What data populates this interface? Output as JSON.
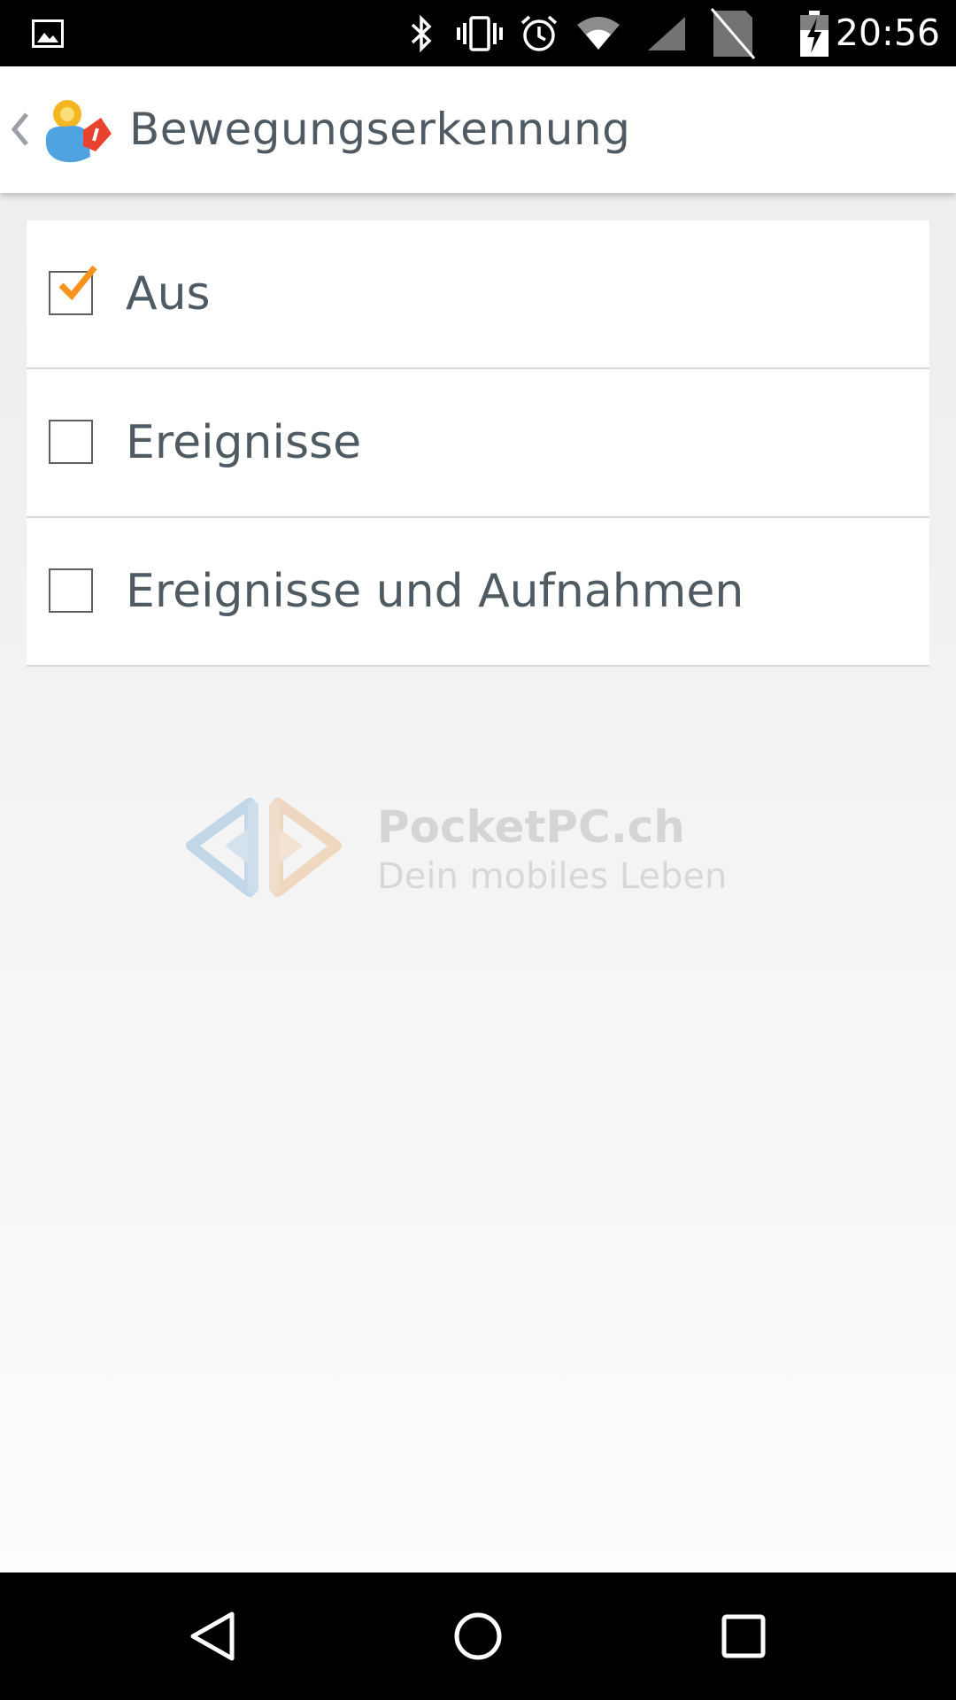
{
  "status_bar": {
    "time": "20:56",
    "icons": [
      "gallery-icon",
      "bluetooth-icon",
      "vibrate-icon",
      "alarm-icon",
      "wifi-icon",
      "signal-icon",
      "no-sim-icon",
      "battery-charging-icon"
    ]
  },
  "action_bar": {
    "title": "Bewegungserkennung",
    "back_icon": "chevron-left-icon",
    "app_icon": "app-logo-icon"
  },
  "options": [
    {
      "label": "Aus",
      "checked": true
    },
    {
      "label": "Ereignisse",
      "checked": false
    },
    {
      "label": "Ereignisse und Aufnahmen",
      "checked": false
    }
  ],
  "colors": {
    "accent": "#f7931e",
    "text": "#4f5a63"
  },
  "watermark": {
    "title": "PocketPC.ch",
    "subtitle": "Dein mobiles Leben"
  },
  "nav_bar": {
    "icons": [
      "back-triangle-icon",
      "home-circle-icon",
      "recents-square-icon"
    ]
  }
}
